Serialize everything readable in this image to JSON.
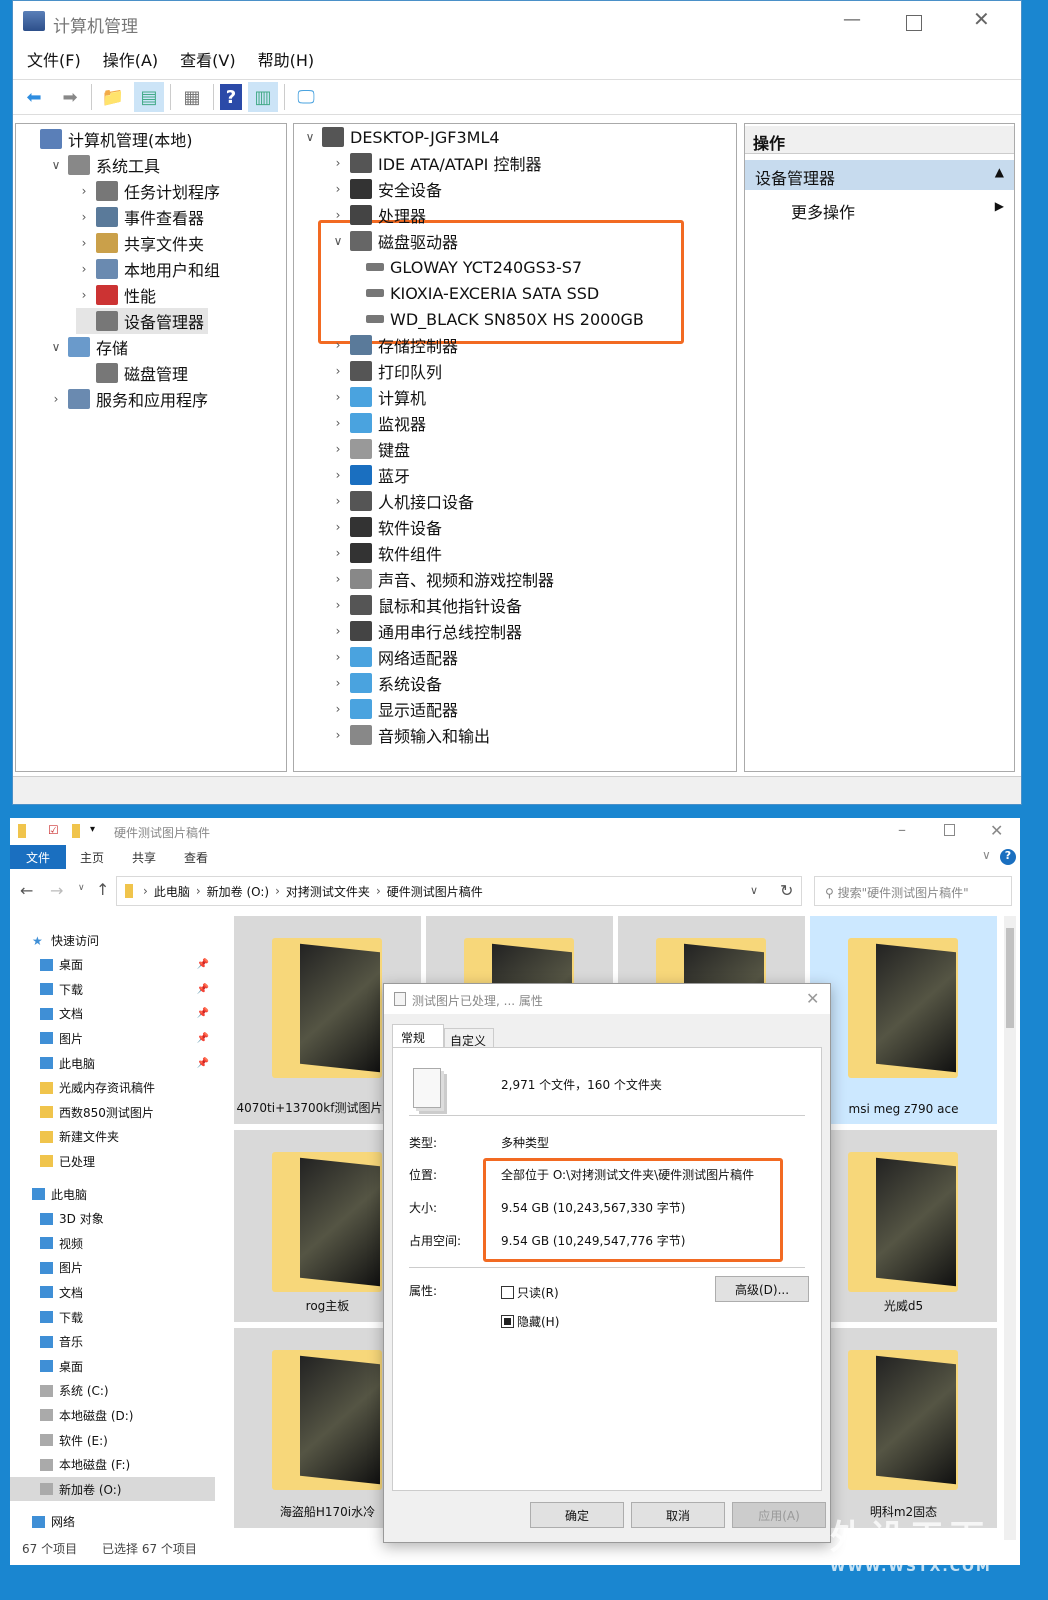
{
  "cm": {
    "title": "计算机管理",
    "menu": [
      "文件(F)",
      "操作(A)",
      "查看(V)",
      "帮助(H)"
    ],
    "toolbar_icons": [
      "back-icon",
      "forward-icon",
      "up-folder-icon",
      "show-hide-tree-icon",
      "properties-icon",
      "help-icon",
      "show-hide-action-icon",
      "monitor-icon"
    ],
    "left_tree": [
      {
        "label": "计算机管理(本地)",
        "level": 0,
        "chev": ""
      },
      {
        "label": "系统工具",
        "level": 1,
        "chev": "v"
      },
      {
        "label": "任务计划程序",
        "level": 2,
        "chev": ">"
      },
      {
        "label": "事件查看器",
        "level": 2,
        "chev": ">"
      },
      {
        "label": "共享文件夹",
        "level": 2,
        "chev": ">"
      },
      {
        "label": "本地用户和组",
        "level": 2,
        "chev": ">"
      },
      {
        "label": "性能",
        "level": 2,
        "chev": ">"
      },
      {
        "label": "设备管理器",
        "level": 2,
        "chev": "",
        "selected": true
      },
      {
        "label": "存储",
        "level": 1,
        "chev": "v"
      },
      {
        "label": "磁盘管理",
        "level": 2,
        "chev": ""
      },
      {
        "label": "服务和应用程序",
        "level": 1,
        "chev": ">"
      }
    ],
    "device_root": "DESKTOP-JGF3ML4",
    "devices": [
      {
        "label": "IDE ATA/ATAPI 控制器",
        "chev": ">"
      },
      {
        "label": "安全设备",
        "chev": ">"
      },
      {
        "label": "处理器",
        "chev": ">"
      },
      {
        "label": "磁盘驱动器",
        "chev": "v"
      },
      {
        "label": "GLOWAY YCT240GS3-S7",
        "child": true
      },
      {
        "label": "KIOXIA-EXCERIA SATA SSD",
        "child": true
      },
      {
        "label": "WD_BLACK SN850X HS 2000GB",
        "child": true
      },
      {
        "label": "存储控制器",
        "chev": ">"
      },
      {
        "label": "打印队列",
        "chev": ">"
      },
      {
        "label": "计算机",
        "chev": ">"
      },
      {
        "label": "监视器",
        "chev": ">"
      },
      {
        "label": "键盘",
        "chev": ">"
      },
      {
        "label": "蓝牙",
        "chev": ">"
      },
      {
        "label": "人机接口设备",
        "chev": ">"
      },
      {
        "label": "软件设备",
        "chev": ">"
      },
      {
        "label": "软件组件",
        "chev": ">"
      },
      {
        "label": "声音、视频和游戏控制器",
        "chev": ">"
      },
      {
        "label": "鼠标和其他指针设备",
        "chev": ">"
      },
      {
        "label": "通用串行总线控制器",
        "chev": ">"
      },
      {
        "label": "网络适配器",
        "chev": ">"
      },
      {
        "label": "系统设备",
        "chev": ">"
      },
      {
        "label": "显示适配器",
        "chev": ">"
      },
      {
        "label": "音频输入和输出",
        "chev": ">"
      }
    ],
    "actions_header": "操作",
    "actions_section": "设备管理器",
    "actions_more": "更多操作"
  },
  "ex": {
    "title": "硬件测试图片稿件",
    "tabs": [
      "文件",
      "主页",
      "共享",
      "查看"
    ],
    "breadcrumb": [
      "此电脑",
      "新加卷 (O:)",
      "对拷测试文件夹",
      "硬件测试图片稿件"
    ],
    "search_placeholder": "搜索\"硬件测试图片稿件\"",
    "nav": [
      {
        "label": "快速访问",
        "level": 0,
        "icon": "star-icon"
      },
      {
        "label": "桌面",
        "level": 1,
        "pin": true
      },
      {
        "label": "下载",
        "level": 1,
        "pin": true
      },
      {
        "label": "文档",
        "level": 1,
        "pin": true
      },
      {
        "label": "图片",
        "level": 1,
        "pin": true
      },
      {
        "label": "此电脑",
        "level": 1,
        "pin": true
      },
      {
        "label": "光威内存资讯稿件",
        "level": 1
      },
      {
        "label": "西数850测试图片",
        "level": 1
      },
      {
        "label": "新建文件夹",
        "level": 1
      },
      {
        "label": "已处理",
        "level": 1
      },
      {
        "label": "此电脑",
        "level": 0,
        "gap": true
      },
      {
        "label": "3D 对象",
        "level": 1
      },
      {
        "label": "视频",
        "level": 1
      },
      {
        "label": "图片",
        "level": 1
      },
      {
        "label": "文档",
        "level": 1
      },
      {
        "label": "下载",
        "level": 1
      },
      {
        "label": "音乐",
        "level": 1
      },
      {
        "label": "桌面",
        "level": 1
      },
      {
        "label": "系统 (C:)",
        "level": 1
      },
      {
        "label": "本地磁盘 (D:)",
        "level": 1
      },
      {
        "label": "软件 (E:)",
        "level": 1
      },
      {
        "label": "本地磁盘 (F:)",
        "level": 1
      },
      {
        "label": "新加卷 (O:)",
        "level": 1,
        "selected": true
      },
      {
        "label": "网络",
        "level": 0,
        "gap": true
      }
    ],
    "tiles": [
      {
        "label": "4070ti+13700kf测试图片稿件理"
      },
      {
        "label": ""
      },
      {
        "label": ""
      },
      {
        "label": "msi meg z790 ace",
        "selected": true
      },
      {
        "label": "rog主板"
      },
      {
        "label": ""
      },
      {
        "label": ""
      },
      {
        "label": "光威d5"
      },
      {
        "label": "海盗船H170i水冷"
      },
      {
        "label": ""
      },
      {
        "label": ""
      },
      {
        "label": "明科m2固态"
      }
    ],
    "status_count": "67 个项目",
    "status_selected": "已选择 67 个项目"
  },
  "dlg": {
    "title": "测试图片已处理, ... 属性",
    "tabs": [
      "常规",
      "自定义"
    ],
    "summary": "2,971 个文件，160 个文件夹",
    "type_label": "类型:",
    "type_value": "多种类型",
    "loc_label": "位置:",
    "loc_value": "全部位于 O:\\对拷测试文件夹\\硬件测试图片稿件",
    "size_label": "大小:",
    "size_value": "9.54 GB (10,243,567,330 字节)",
    "disk_label": "占用空间:",
    "disk_value": "9.54 GB (10,249,547,776 字节)",
    "attr_label": "属性:",
    "readonly": "只读(R)",
    "readonly_checked": false,
    "hidden": "隐藏(H)",
    "hidden_state": "indeterminate",
    "advanced": "高级(D)...",
    "ok": "确定",
    "cancel": "取消",
    "apply": "应用(A)"
  },
  "watermark": "外设天下 WWW.WSTX.COM",
  "colors": {
    "highlight": "#f26a22",
    "selection": "#cce8ff",
    "accent": "#1a6fc0"
  }
}
